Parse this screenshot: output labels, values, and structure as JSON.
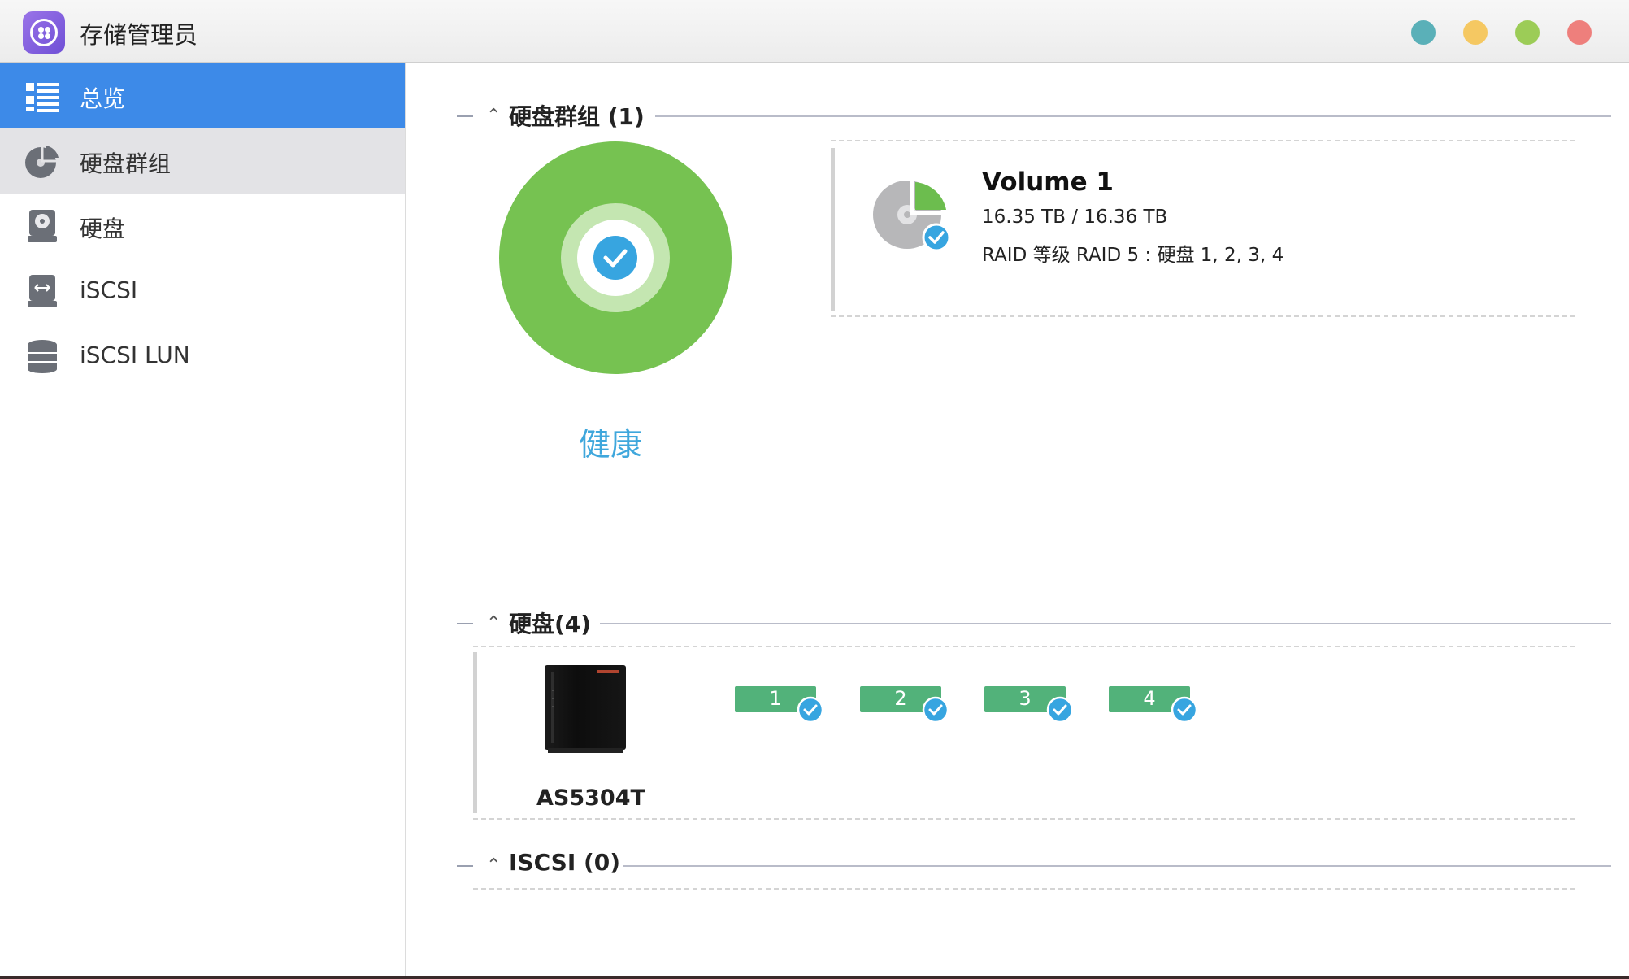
{
  "app": {
    "title": "存储管理员"
  },
  "window_buttons": [
    {
      "name": "teal",
      "color": "#5ab0b8"
    },
    {
      "name": "yellow",
      "color": "#f5c862"
    },
    {
      "name": "green",
      "color": "#9ccc57"
    },
    {
      "name": "red",
      "color": "#ee7f7c"
    }
  ],
  "sidebar": {
    "items": [
      {
        "label": "总览",
        "icon": "list-icon",
        "state": "active"
      },
      {
        "label": "硬盘群组",
        "icon": "volume-pie-icon",
        "state": "hover"
      },
      {
        "label": "硬盘",
        "icon": "hard-drive-icon",
        "state": "normal"
      },
      {
        "label": "iSCSI",
        "icon": "iscsi-icon",
        "state": "normal"
      },
      {
        "label": "iSCSI LUN",
        "icon": "database-icon",
        "state": "normal"
      }
    ]
  },
  "sections": {
    "volume_group": {
      "title": "硬盘群组 (1)"
    },
    "disks": {
      "title": "硬盘(4)"
    },
    "iscsi": {
      "title": "ISCSI (0)"
    }
  },
  "health": {
    "label": "健康",
    "color": "#76c251"
  },
  "volume": {
    "name": "Volume 1",
    "size": "16.35 TB / 16.36 TB",
    "raid": "RAID 等级 RAID 5 : 硬盘 1, 2, 3, 4"
  },
  "device": {
    "model": "AS5304T"
  },
  "disks": [
    {
      "number": "1",
      "status": "ok"
    },
    {
      "number": "2",
      "status": "ok"
    },
    {
      "number": "3",
      "status": "ok"
    },
    {
      "number": "4",
      "status": "ok"
    }
  ],
  "colors": {
    "accent": "#3d8ae8",
    "ok": "#52b27a",
    "check": "#37a5e0"
  }
}
